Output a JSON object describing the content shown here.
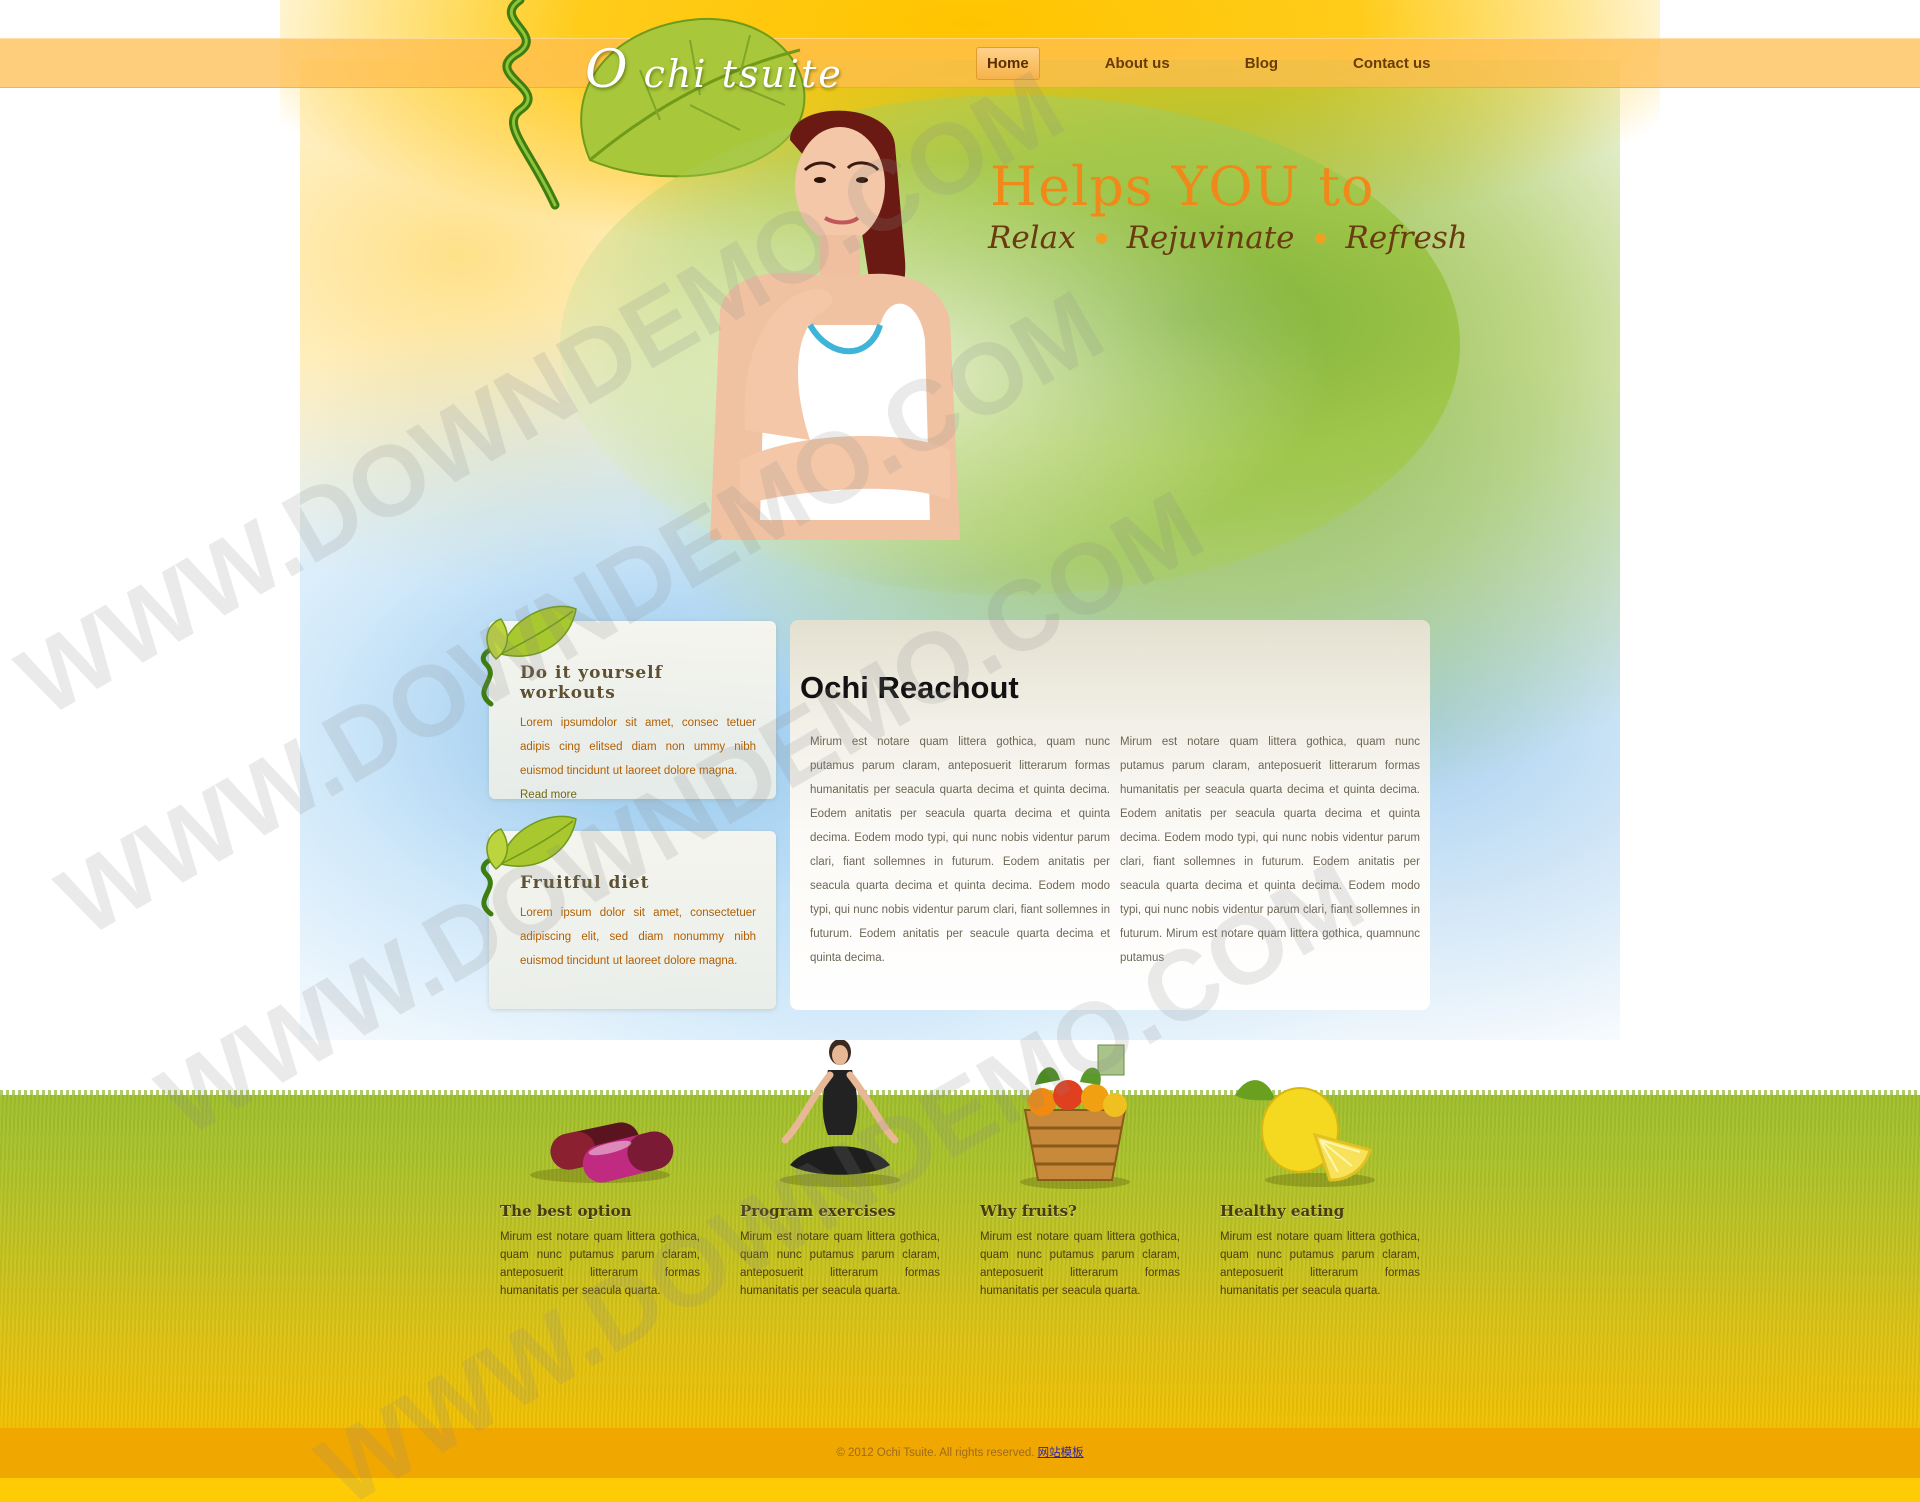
{
  "brand": {
    "logo_initial": "O",
    "logo_rest": "chi tsuite"
  },
  "nav": {
    "items": [
      {
        "label": "Home",
        "active": true
      },
      {
        "label": "About us",
        "active": false
      },
      {
        "label": "Blog",
        "active": false
      },
      {
        "label": "Contact us",
        "active": false
      }
    ]
  },
  "hero": {
    "title": "Helps YOU to",
    "words": [
      "Relax",
      "Rejuvinate",
      "Refresh"
    ]
  },
  "sidebar_boxes": [
    {
      "title": "Do it yourself workouts",
      "text": "Lorem ipsumdolor sit amet, consec tetuer adipis cing elitsed diam non ummy nibh euismod tincidunt ut laoreet dolore magna.",
      "link": "Read more"
    },
    {
      "title": "Fruitful diet",
      "text": "Lorem ipsum dolor sit amet, consectetuer adipiscing elit, sed diam nonummy nibh euismod tincidunt ut laoreet dolore magna."
    }
  ],
  "reachout": {
    "title": "Ochi Reachout",
    "col1": "Mirum est notare quam littera gothica, quam nunc putamus parum claram, anteposuerit litterarum formas humanitatis per seacula quarta decima et quinta decima. Eodem anitatis per seacula quarta decima et quinta decima. Eodem modo typi, qui nunc nobis videntur parum clari, fiant sollemnes in futurum. Eodem anitatis per seacula quarta decima et quinta decima. Eodem modo typi, qui nunc nobis videntur parum clari, fiant sollemnes in futurum. Eodem anitatis per seacule quarta decima et quinta decima.",
    "col2": "Mirum est notare quam littera gothica, quam nunc putamus parum claram, anteposuerit litterarum formas humanitatis per seacula quarta decima et quinta decima. Eodem anitatis per seacula quarta decima et quinta decima. Eodem modo typi, qui nunc nobis videntur parum clari, fiant sollemnes in futurum. Eodem anitatis per seacula quarta decima et quinta decima. Eodem modo typi, qui nunc nobis videntur parum clari, fiant sollemnes in futurum. Mirum est notare quam littera gothica, quamnunc putamus"
  },
  "features": [
    {
      "icon": "capsules-icon",
      "title": "The best option",
      "text": "Mirum est notare quam littera gothica, quam nunc putamus parum claram, anteposuerit litterarum formas humanitatis per seacula quarta."
    },
    {
      "icon": "meditation-icon",
      "title": "Program exercises",
      "text": "Mirum est notare quam littera gothica, quam nunc putamus parum claram, anteposuerit litterarum formas humanitatis per seacula quarta."
    },
    {
      "icon": "fruit-basket-icon",
      "title": "Why fruits?",
      "text": "Mirum est notare quam littera gothica, quam nunc putamus parum claram, anteposuerit litterarum formas humanitatis per seacula quarta."
    },
    {
      "icon": "lemon-icon",
      "title": "Healthy eating",
      "text": "Mirum est notare quam littera gothica, quam nunc putamus parum claram, anteposuerit litterarum formas humanitatis per seacula quarta."
    }
  ],
  "footer": {
    "copyright": "© 2012 Ochi Tsuite. All rights reserved.",
    "link": "网站模板"
  },
  "watermark": "WWW.DOWNDEMO.COM",
  "colors": {
    "brand_yellow": "#ffc400",
    "nav_text": "#6b3b06",
    "hero_orange": "#f0891a",
    "box_text": "#b25e00",
    "footer_bar": "#f0a800"
  }
}
